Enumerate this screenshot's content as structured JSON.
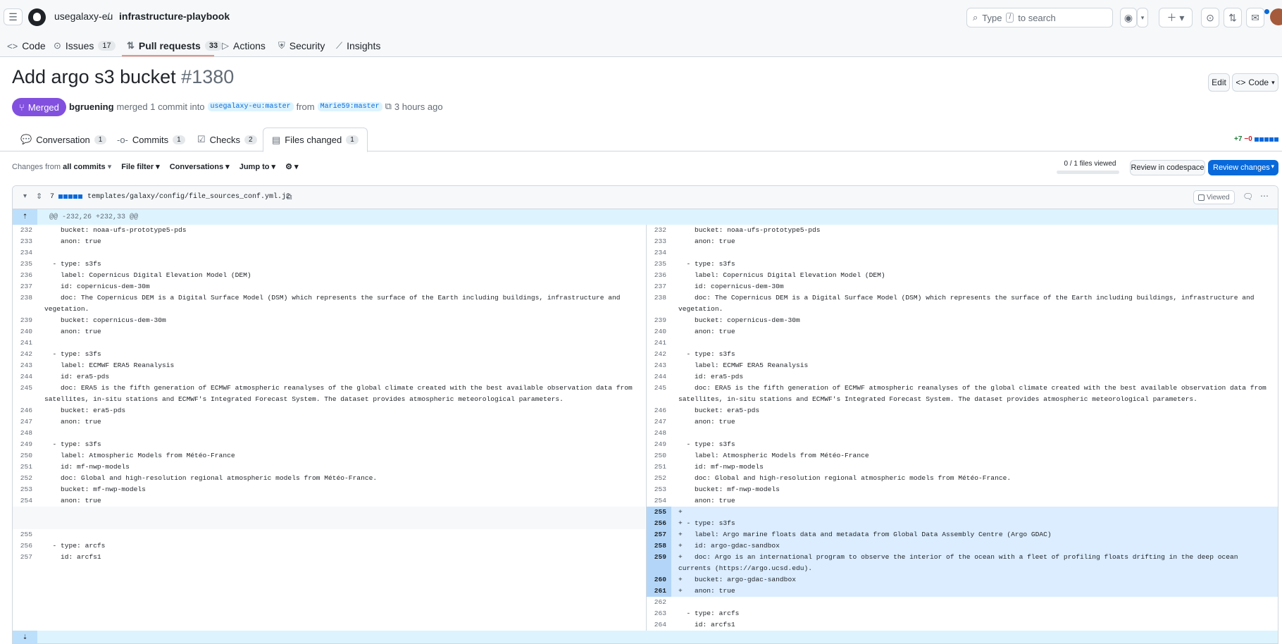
{
  "repo": {
    "owner": "usegalaxy-eu",
    "separator": "/",
    "name": "infrastructure-playbook"
  },
  "search": {
    "prefix": "Type",
    "key": "/",
    "suffix": "to search"
  },
  "nav": [
    {
      "label": "Code",
      "icon": "<>",
      "count": ""
    },
    {
      "label": "Issues",
      "icon": "⊙",
      "count": "17"
    },
    {
      "label": "Pull requests",
      "icon": "⇅",
      "count": "33"
    },
    {
      "label": "Actions",
      "icon": "▷",
      "count": ""
    },
    {
      "label": "Security",
      "icon": "⛨",
      "count": ""
    },
    {
      "label": "Insights",
      "icon": "⟋",
      "count": ""
    }
  ],
  "pr": {
    "title": "Add argo s3 bucket",
    "number": "#1380",
    "status": "Merged",
    "author": "bgruening",
    "merged_text": "merged 1 commit into",
    "base": "usegalaxy-eu:master",
    "from": "from",
    "head": "Marie59:master",
    "time": "3 hours ago",
    "edit_label": "Edit",
    "code_label": "Code"
  },
  "tabs": [
    {
      "label": "Conversation",
      "count": "1"
    },
    {
      "label": "Commits",
      "count": "1"
    },
    {
      "label": "Checks",
      "count": "2"
    },
    {
      "label": "Files changed",
      "count": "1"
    }
  ],
  "diffstat": {
    "add": "+7",
    "del": "−0"
  },
  "toolbar": {
    "changes_from": "Changes from",
    "all_commits": "all commits",
    "file_filter": "File filter",
    "conversations": "Conversations",
    "jump_to": "Jump to",
    "files_viewed": "0 / 1 files viewed",
    "review_codespace": "Review in codespace",
    "review_changes": "Review changes"
  },
  "file": {
    "changes": "7",
    "path": "templates/galaxy/config/file_sources_conf.yml.j2",
    "viewed_label": "Viewed",
    "hunk": "@@ -232,26 +232,33 @@"
  },
  "left_lines": [
    {
      "n": "232",
      "t": "    bucket: noaa-ufs-prototype5-pds"
    },
    {
      "n": "233",
      "t": "    anon: true"
    },
    {
      "n": "234",
      "t": ""
    },
    {
      "n": "235",
      "t": "  - type: s3fs"
    },
    {
      "n": "236",
      "t": "    label: Copernicus Digital Elevation Model (DEM)"
    },
    {
      "n": "237",
      "t": "    id: copernicus-dem-30m"
    },
    {
      "n": "238",
      "t": "    doc: The Copernicus DEM is a Digital Surface Model (DSM) which represents the surface of the Earth including buildings, infrastructure and vegetation."
    },
    {
      "n": "239",
      "t": "    bucket: copernicus-dem-30m"
    },
    {
      "n": "240",
      "t": "    anon: true"
    },
    {
      "n": "241",
      "t": ""
    },
    {
      "n": "242",
      "t": "  - type: s3fs"
    },
    {
      "n": "243",
      "t": "    label: ECMWF ERA5 Reanalysis"
    },
    {
      "n": "244",
      "t": "    id: era5-pds"
    },
    {
      "n": "245",
      "t": "    doc: ERA5 is the fifth generation of ECMWF atmospheric reanalyses of the global climate created with the best available observation data from satellites, in-situ stations and ECMWF's Integrated Forecast System. The dataset provides atmospheric meteorological parameters."
    },
    {
      "n": "246",
      "t": "    bucket: era5-pds"
    },
    {
      "n": "247",
      "t": "    anon: true"
    },
    {
      "n": "248",
      "t": ""
    },
    {
      "n": "249",
      "t": "  - type: s3fs"
    },
    {
      "n": "250",
      "t": "    label: Atmospheric Models from Météo-France"
    },
    {
      "n": "251",
      "t": "    id: mf-nwp-models"
    },
    {
      "n": "252",
      "t": "    doc: Global and high-resolution regional atmospheric models from Météo-France."
    },
    {
      "n": "253",
      "t": "    bucket: mf-nwp-models"
    },
    {
      "n": "254",
      "t": "    anon: true"
    },
    {
      "n": "",
      "t": "",
      "blank": true
    },
    {
      "n": "",
      "t": "",
      "blank": true
    },
    {
      "n": "",
      "t": "",
      "blank": true
    },
    {
      "n": "",
      "t": "",
      "blank": true
    },
    {
      "n": "",
      "t": "",
      "blank": true,
      "tall": true
    },
    {
      "n": "",
      "t": "",
      "blank": true
    },
    {
      "n": "",
      "t": "",
      "blank": true
    },
    {
      "n": "255",
      "t": ""
    },
    {
      "n": "256",
      "t": "  - type: arcfs"
    },
    {
      "n": "257",
      "t": "    id: arcfs1"
    }
  ],
  "right_lines": [
    {
      "n": "232",
      "t": "    bucket: noaa-ufs-prototype5-pds"
    },
    {
      "n": "233",
      "t": "    anon: true"
    },
    {
      "n": "234",
      "t": ""
    },
    {
      "n": "235",
      "t": "  - type: s3fs"
    },
    {
      "n": "236",
      "t": "    label: Copernicus Digital Elevation Model (DEM)"
    },
    {
      "n": "237",
      "t": "    id: copernicus-dem-30m"
    },
    {
      "n": "238",
      "t": "    doc: The Copernicus DEM is a Digital Surface Model (DSM) which represents the surface of the Earth including buildings, infrastructure and vegetation."
    },
    {
      "n": "239",
      "t": "    bucket: copernicus-dem-30m"
    },
    {
      "n": "240",
      "t": "    anon: true"
    },
    {
      "n": "241",
      "t": ""
    },
    {
      "n": "242",
      "t": "  - type: s3fs"
    },
    {
      "n": "243",
      "t": "    label: ECMWF ERA5 Reanalysis"
    },
    {
      "n": "244",
      "t": "    id: era5-pds"
    },
    {
      "n": "245",
      "t": "    doc: ERA5 is the fifth generation of ECMWF atmospheric reanalyses of the global climate created with the best available observation data from satellites, in-situ stations and ECMWF's Integrated Forecast System. The dataset provides atmospheric meteorological parameters."
    },
    {
      "n": "246",
      "t": "    bucket: era5-pds"
    },
    {
      "n": "247",
      "t": "    anon: true"
    },
    {
      "n": "248",
      "t": ""
    },
    {
      "n": "249",
      "t": "  - type: s3fs"
    },
    {
      "n": "250",
      "t": "    label: Atmospheric Models from Météo-France"
    },
    {
      "n": "251",
      "t": "    id: mf-nwp-models"
    },
    {
      "n": "252",
      "t": "    doc: Global and high-resolution regional atmospheric models from Météo-France."
    },
    {
      "n": "253",
      "t": "    bucket: mf-nwp-models"
    },
    {
      "n": "254",
      "t": "    anon: true"
    },
    {
      "n": "255",
      "t": "+",
      "added": true
    },
    {
      "n": "256",
      "t": "+ - type: s3fs",
      "added": true
    },
    {
      "n": "257",
      "t": "+   label: Argo marine floats data and metadata from Global Data Assembly Centre (Argo GDAC)",
      "added": true
    },
    {
      "n": "258",
      "t": "+   id: argo-gdac-sandbox",
      "added": true
    },
    {
      "n": "259",
      "t": "+   doc: Argo is an international program to observe the interior of the ocean with a fleet of profiling floats drifting in the deep ocean currents (https://argo.ucsd.edu).",
      "added": true
    },
    {
      "n": "260",
      "t": "+   bucket: argo-gdac-sandbox",
      "added": true
    },
    {
      "n": "261",
      "t": "+   anon: true",
      "added": true
    },
    {
      "n": "262",
      "t": ""
    },
    {
      "n": "263",
      "t": "  - type: arcfs"
    },
    {
      "n": "264",
      "t": "    id: arcfs1"
    }
  ]
}
